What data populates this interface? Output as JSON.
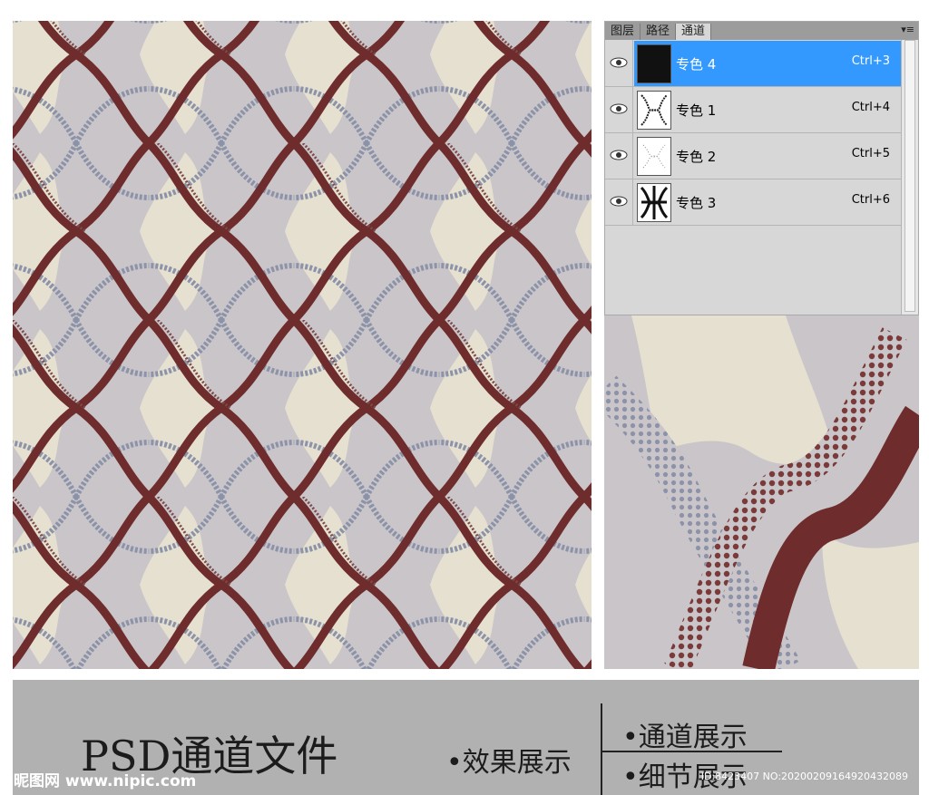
{
  "panel": {
    "tabs": [
      "图层",
      "路径",
      "通道"
    ],
    "active_tab": 2,
    "channels": [
      {
        "name": "专色 4",
        "shortcut": "Ctrl+3",
        "selected": true
      },
      {
        "name": "专色 1",
        "shortcut": "Ctrl+4",
        "selected": false
      },
      {
        "name": "专色 2",
        "shortcut": "Ctrl+5",
        "selected": false
      },
      {
        "name": "专色 3",
        "shortcut": "Ctrl+6",
        "selected": false
      }
    ]
  },
  "footer": {
    "title": "PSD通道文件",
    "effect": "•效果展示",
    "channel": "•通道展示",
    "detail": "•细节展示",
    "watermark": "昵图网 www.nipic.com",
    "id_text": "ID:8423407 NO:20200209164920432089"
  },
  "colors": {
    "bg": "#c9c5c9",
    "cream": "#e5e0d0",
    "maroon": "#6e2c2c",
    "blue_gray": "#8c93a8",
    "selection": "#3399ff"
  },
  "icons": [
    "eye-icon",
    "panel-menu-icon"
  ]
}
